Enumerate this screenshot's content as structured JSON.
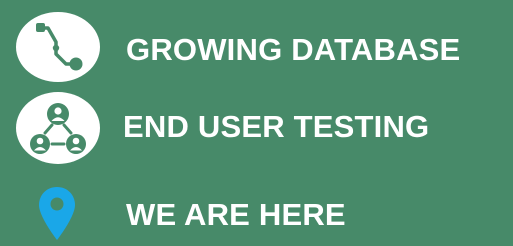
{
  "colors": {
    "background": "#478a69",
    "icon_circle": "#ffffff",
    "icon_glyph": "#478a69",
    "pin": "#1aa7e8",
    "text": "#ffffff"
  },
  "items": [
    {
      "label": "GROWING DATABASE",
      "icon": "path-nodes-icon"
    },
    {
      "label": "END USER TESTING",
      "icon": "user-network-icon"
    },
    {
      "label": "WE ARE HERE",
      "icon": "location-pin-icon"
    }
  ]
}
